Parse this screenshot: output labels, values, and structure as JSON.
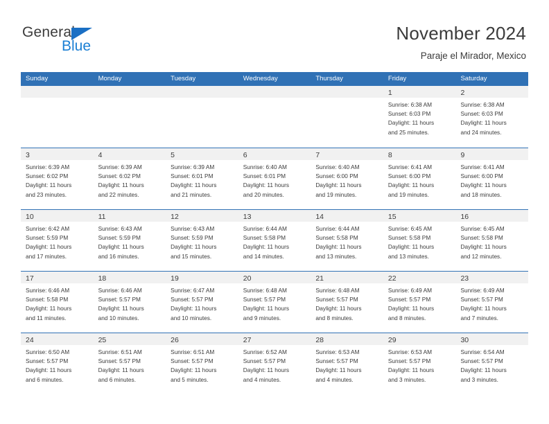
{
  "brand": {
    "line1": "General",
    "line2": "Blue",
    "triangle_icon": "blue-triangle-logo-mark",
    "accent_color": "#1a7fd4"
  },
  "header": {
    "title": "November 2024",
    "subtitle": "Paraje el Mirador, Mexico"
  },
  "theme": {
    "header_blue": "#3071b5",
    "day_band_gray": "#f1f1f1",
    "text_color": "#3b3b3b"
  },
  "calendar": {
    "weekdays": [
      "Sunday",
      "Monday",
      "Tuesday",
      "Wednesday",
      "Thursday",
      "Friday",
      "Saturday"
    ],
    "weeks": [
      [
        {
          "day": "",
          "empty": true,
          "sunrise": "",
          "sunset": "",
          "daylight1": "",
          "daylight2": ""
        },
        {
          "day": "",
          "empty": true,
          "sunrise": "",
          "sunset": "",
          "daylight1": "",
          "daylight2": ""
        },
        {
          "day": "",
          "empty": true,
          "sunrise": "",
          "sunset": "",
          "daylight1": "",
          "daylight2": ""
        },
        {
          "day": "",
          "empty": true,
          "sunrise": "",
          "sunset": "",
          "daylight1": "",
          "daylight2": ""
        },
        {
          "day": "",
          "empty": true,
          "sunrise": "",
          "sunset": "",
          "daylight1": "",
          "daylight2": ""
        },
        {
          "day": "1",
          "empty": false,
          "sunrise": "Sunrise: 6:38 AM",
          "sunset": "Sunset: 6:03 PM",
          "daylight1": "Daylight: 11 hours",
          "daylight2": "and 25 minutes."
        },
        {
          "day": "2",
          "empty": false,
          "sunrise": "Sunrise: 6:38 AM",
          "sunset": "Sunset: 6:03 PM",
          "daylight1": "Daylight: 11 hours",
          "daylight2": "and 24 minutes."
        }
      ],
      [
        {
          "day": "3",
          "empty": false,
          "sunrise": "Sunrise: 6:39 AM",
          "sunset": "Sunset: 6:02 PM",
          "daylight1": "Daylight: 11 hours",
          "daylight2": "and 23 minutes."
        },
        {
          "day": "4",
          "empty": false,
          "sunrise": "Sunrise: 6:39 AM",
          "sunset": "Sunset: 6:02 PM",
          "daylight1": "Daylight: 11 hours",
          "daylight2": "and 22 minutes."
        },
        {
          "day": "5",
          "empty": false,
          "sunrise": "Sunrise: 6:39 AM",
          "sunset": "Sunset: 6:01 PM",
          "daylight1": "Daylight: 11 hours",
          "daylight2": "and 21 minutes."
        },
        {
          "day": "6",
          "empty": false,
          "sunrise": "Sunrise: 6:40 AM",
          "sunset": "Sunset: 6:01 PM",
          "daylight1": "Daylight: 11 hours",
          "daylight2": "and 20 minutes."
        },
        {
          "day": "7",
          "empty": false,
          "sunrise": "Sunrise: 6:40 AM",
          "sunset": "Sunset: 6:00 PM",
          "daylight1": "Daylight: 11 hours",
          "daylight2": "and 19 minutes."
        },
        {
          "day": "8",
          "empty": false,
          "sunrise": "Sunrise: 6:41 AM",
          "sunset": "Sunset: 6:00 PM",
          "daylight1": "Daylight: 11 hours",
          "daylight2": "and 19 minutes."
        },
        {
          "day": "9",
          "empty": false,
          "sunrise": "Sunrise: 6:41 AM",
          "sunset": "Sunset: 6:00 PM",
          "daylight1": "Daylight: 11 hours",
          "daylight2": "and 18 minutes."
        }
      ],
      [
        {
          "day": "10",
          "empty": false,
          "sunrise": "Sunrise: 6:42 AM",
          "sunset": "Sunset: 5:59 PM",
          "daylight1": "Daylight: 11 hours",
          "daylight2": "and 17 minutes."
        },
        {
          "day": "11",
          "empty": false,
          "sunrise": "Sunrise: 6:43 AM",
          "sunset": "Sunset: 5:59 PM",
          "daylight1": "Daylight: 11 hours",
          "daylight2": "and 16 minutes."
        },
        {
          "day": "12",
          "empty": false,
          "sunrise": "Sunrise: 6:43 AM",
          "sunset": "Sunset: 5:59 PM",
          "daylight1": "Daylight: 11 hours",
          "daylight2": "and 15 minutes."
        },
        {
          "day": "13",
          "empty": false,
          "sunrise": "Sunrise: 6:44 AM",
          "sunset": "Sunset: 5:58 PM",
          "daylight1": "Daylight: 11 hours",
          "daylight2": "and 14 minutes."
        },
        {
          "day": "14",
          "empty": false,
          "sunrise": "Sunrise: 6:44 AM",
          "sunset": "Sunset: 5:58 PM",
          "daylight1": "Daylight: 11 hours",
          "daylight2": "and 13 minutes."
        },
        {
          "day": "15",
          "empty": false,
          "sunrise": "Sunrise: 6:45 AM",
          "sunset": "Sunset: 5:58 PM",
          "daylight1": "Daylight: 11 hours",
          "daylight2": "and 13 minutes."
        },
        {
          "day": "16",
          "empty": false,
          "sunrise": "Sunrise: 6:45 AM",
          "sunset": "Sunset: 5:58 PM",
          "daylight1": "Daylight: 11 hours",
          "daylight2": "and 12 minutes."
        }
      ],
      [
        {
          "day": "17",
          "empty": false,
          "sunrise": "Sunrise: 6:46 AM",
          "sunset": "Sunset: 5:58 PM",
          "daylight1": "Daylight: 11 hours",
          "daylight2": "and 11 minutes."
        },
        {
          "day": "18",
          "empty": false,
          "sunrise": "Sunrise: 6:46 AM",
          "sunset": "Sunset: 5:57 PM",
          "daylight1": "Daylight: 11 hours",
          "daylight2": "and 10 minutes."
        },
        {
          "day": "19",
          "empty": false,
          "sunrise": "Sunrise: 6:47 AM",
          "sunset": "Sunset: 5:57 PM",
          "daylight1": "Daylight: 11 hours",
          "daylight2": "and 10 minutes."
        },
        {
          "day": "20",
          "empty": false,
          "sunrise": "Sunrise: 6:48 AM",
          "sunset": "Sunset: 5:57 PM",
          "daylight1": "Daylight: 11 hours",
          "daylight2": "and 9 minutes."
        },
        {
          "day": "21",
          "empty": false,
          "sunrise": "Sunrise: 6:48 AM",
          "sunset": "Sunset: 5:57 PM",
          "daylight1": "Daylight: 11 hours",
          "daylight2": "and 8 minutes."
        },
        {
          "day": "22",
          "empty": false,
          "sunrise": "Sunrise: 6:49 AM",
          "sunset": "Sunset: 5:57 PM",
          "daylight1": "Daylight: 11 hours",
          "daylight2": "and 8 minutes."
        },
        {
          "day": "23",
          "empty": false,
          "sunrise": "Sunrise: 6:49 AM",
          "sunset": "Sunset: 5:57 PM",
          "daylight1": "Daylight: 11 hours",
          "daylight2": "and 7 minutes."
        }
      ],
      [
        {
          "day": "24",
          "empty": false,
          "sunrise": "Sunrise: 6:50 AM",
          "sunset": "Sunset: 5:57 PM",
          "daylight1": "Daylight: 11 hours",
          "daylight2": "and 6 minutes."
        },
        {
          "day": "25",
          "empty": false,
          "sunrise": "Sunrise: 6:51 AM",
          "sunset": "Sunset: 5:57 PM",
          "daylight1": "Daylight: 11 hours",
          "daylight2": "and 6 minutes."
        },
        {
          "day": "26",
          "empty": false,
          "sunrise": "Sunrise: 6:51 AM",
          "sunset": "Sunset: 5:57 PM",
          "daylight1": "Daylight: 11 hours",
          "daylight2": "and 5 minutes."
        },
        {
          "day": "27",
          "empty": false,
          "sunrise": "Sunrise: 6:52 AM",
          "sunset": "Sunset: 5:57 PM",
          "daylight1": "Daylight: 11 hours",
          "daylight2": "and 4 minutes."
        },
        {
          "day": "28",
          "empty": false,
          "sunrise": "Sunrise: 6:53 AM",
          "sunset": "Sunset: 5:57 PM",
          "daylight1": "Daylight: 11 hours",
          "daylight2": "and 4 minutes."
        },
        {
          "day": "29",
          "empty": false,
          "sunrise": "Sunrise: 6:53 AM",
          "sunset": "Sunset: 5:57 PM",
          "daylight1": "Daylight: 11 hours",
          "daylight2": "and 3 minutes."
        },
        {
          "day": "30",
          "empty": false,
          "sunrise": "Sunrise: 6:54 AM",
          "sunset": "Sunset: 5:57 PM",
          "daylight1": "Daylight: 11 hours",
          "daylight2": "and 3 minutes."
        }
      ]
    ]
  }
}
